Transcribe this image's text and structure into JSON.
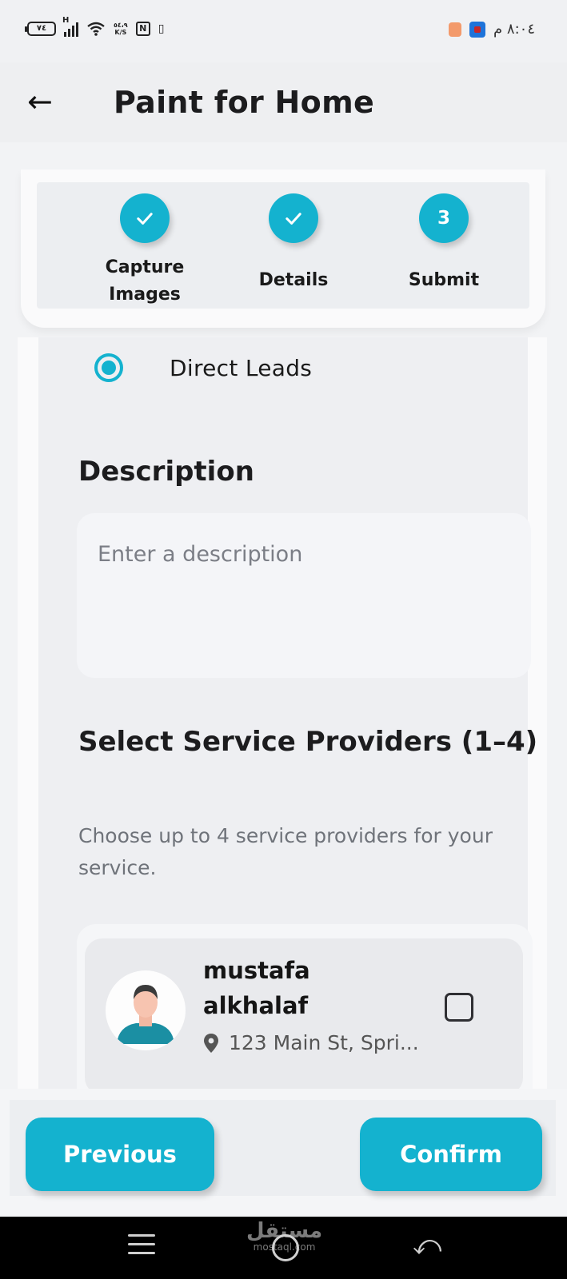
{
  "status_bar": {
    "battery": "٧٤",
    "network": "H",
    "speed_value": "٥٤،٩",
    "speed_unit": "K/S",
    "nfc": "N",
    "vibrate": "▯",
    "time": "٨:٠٤ م"
  },
  "header": {
    "back_icon": "←",
    "title": "Paint for Home"
  },
  "stepper": {
    "steps": [
      {
        "label": "Capture\nImages",
        "state": "done",
        "icon": "check-icon"
      },
      {
        "label": "Details",
        "state": "done",
        "icon": "check-icon"
      },
      {
        "label": "Submit",
        "state": "current",
        "number": "3"
      }
    ]
  },
  "form": {
    "lead_option": "Direct Leads",
    "lead_selected": true,
    "description_title": "Description",
    "description_placeholder": "Enter a description",
    "description_value": "",
    "providers_title": "Select Service Providers (1–4)",
    "providers_subtitle": "Choose up to 4 service providers for your service.",
    "providers": [
      {
        "name": "mustafa alkhalaf",
        "location": "123 Main St, Spri...",
        "selected": false
      }
    ]
  },
  "footer": {
    "previous_label": "Previous",
    "confirm_label": "Confirm"
  },
  "system_nav": {
    "watermark_ar": "مستقل",
    "watermark_en": "mostaql.com"
  },
  "colors": {
    "accent": "#14b2cf",
    "background": "#f2f3f5"
  }
}
